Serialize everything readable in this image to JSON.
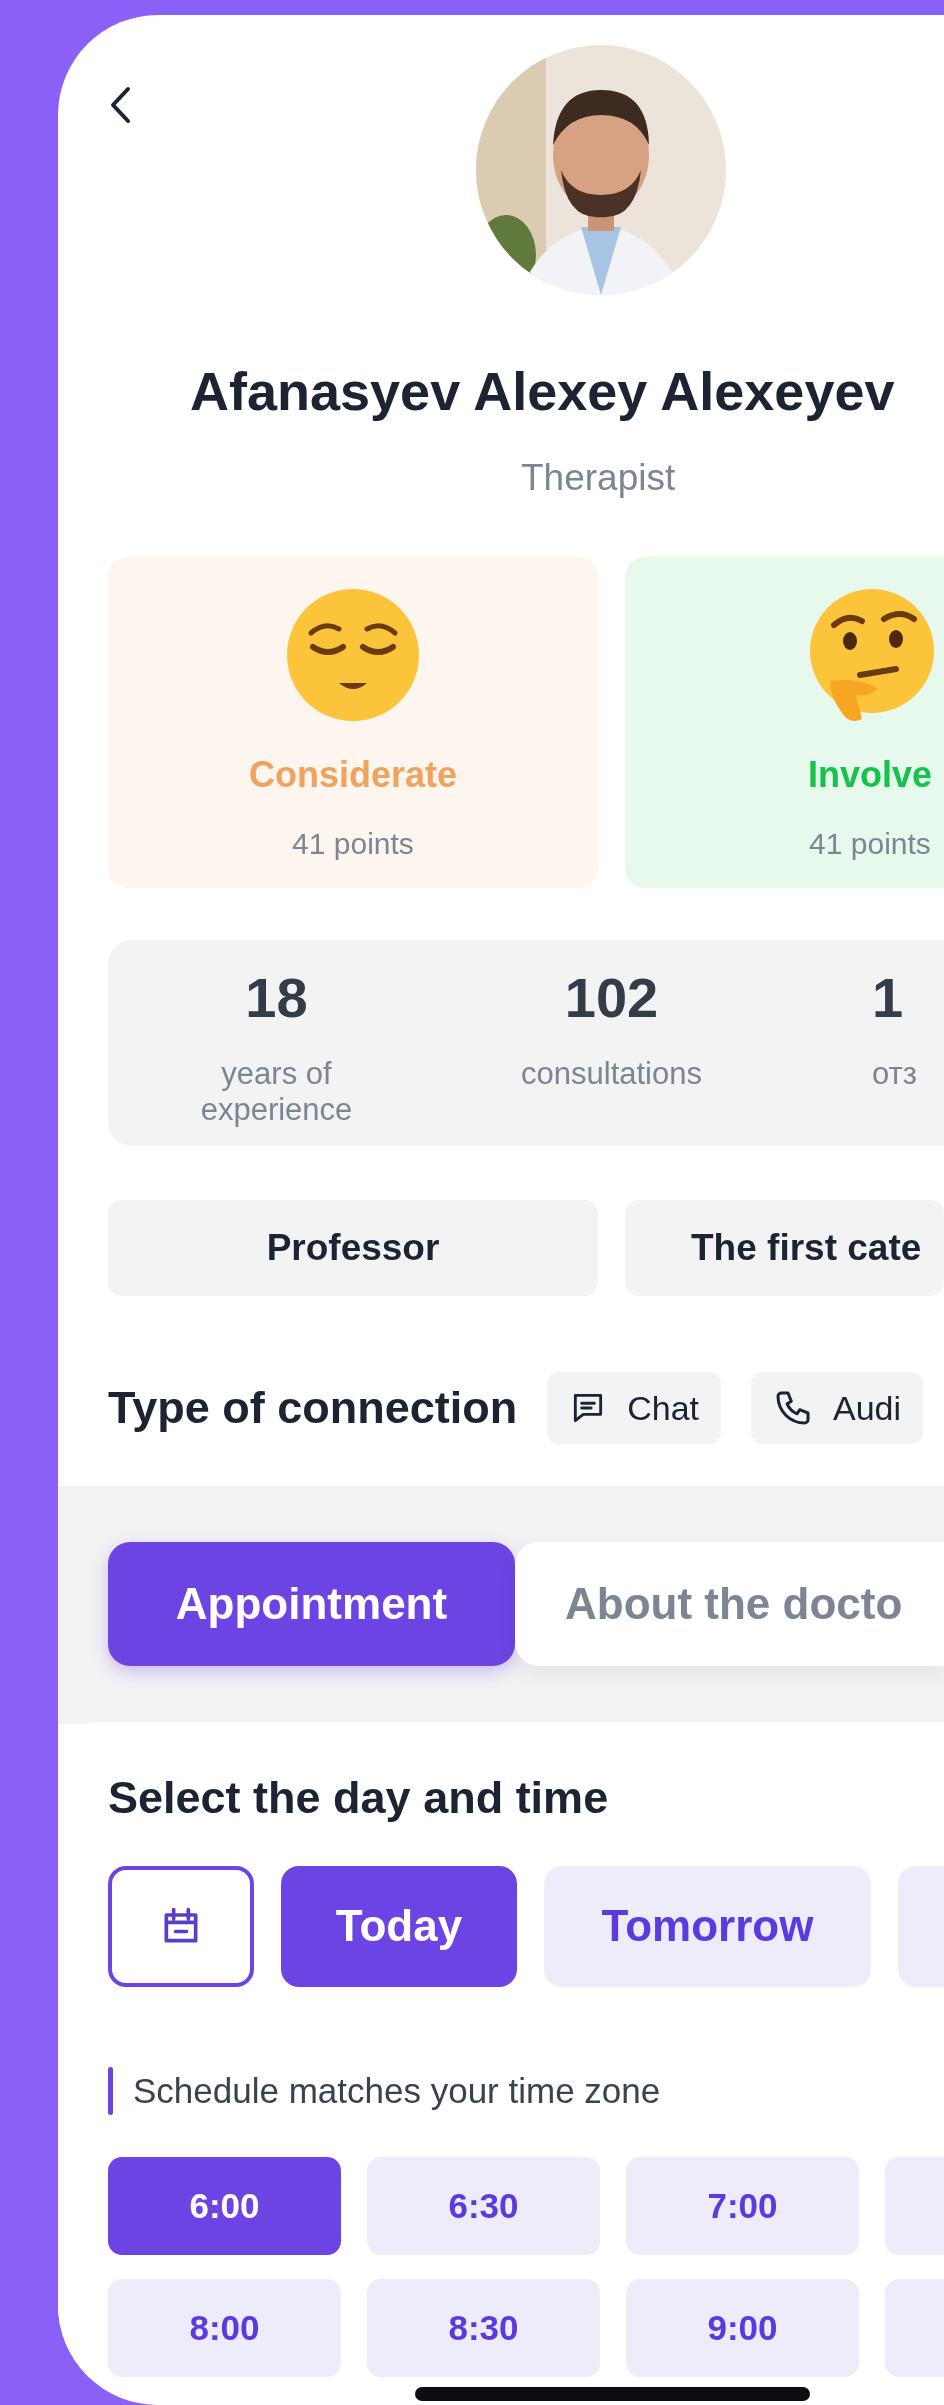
{
  "doctor": {
    "name": "Afanasyev Alexey Alexeyev",
    "specialty": "Therapist"
  },
  "traits": [
    {
      "kind": "relieved",
      "label": "Considerate",
      "points": "41 points",
      "color": "#f0a35e"
    },
    {
      "kind": "thinking",
      "label": "Involve",
      "points": "41 points",
      "color": "#16c24a"
    }
  ],
  "stats": [
    {
      "value": "18",
      "label": "years of experience"
    },
    {
      "value": "102",
      "label": "consultations"
    },
    {
      "value": "1",
      "label": "отз"
    }
  ],
  "titles": [
    "Professor",
    "The first cate"
  ],
  "connection": {
    "title": "Type of connection",
    "types": [
      {
        "kind": "chat",
        "label": "Chat"
      },
      {
        "kind": "audio",
        "label": "Audi"
      }
    ]
  },
  "tabs": [
    {
      "label": "Appointment",
      "selected": true
    },
    {
      "label": "About the docto",
      "selected": false
    }
  ],
  "schedule": {
    "title": "Select the day and time",
    "days": [
      {
        "label": "Today",
        "selected": true
      },
      {
        "label": "Tomorrow",
        "selected": false
      }
    ],
    "note": "Schedule matches your time zone",
    "times": [
      {
        "label": "6:00",
        "selected": true
      },
      {
        "label": "6:30",
        "selected": false
      },
      {
        "label": "7:00",
        "selected": false
      },
      {
        "label": "8:00",
        "selected": false
      },
      {
        "label": "8:30",
        "selected": false
      },
      {
        "label": "9:00",
        "selected": false
      }
    ]
  }
}
